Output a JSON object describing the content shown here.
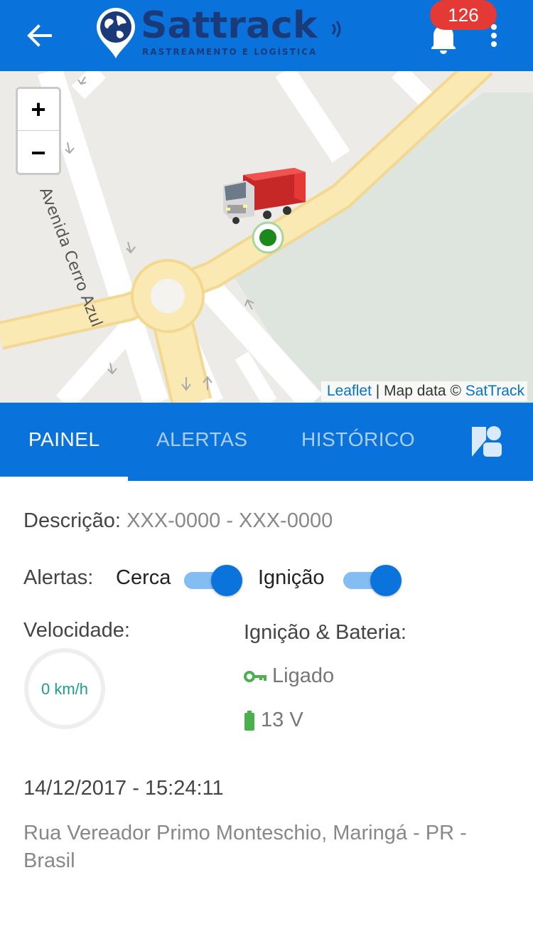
{
  "header": {
    "logo_title": "Sattrack",
    "logo_subtitle": "RASTREAMENTO E LOGÍSTICA",
    "notification_count": "126",
    "icons": [
      "back-arrow-icon",
      "logo-pin-globe-icon",
      "bell-icon",
      "more-vertical-icon"
    ],
    "color": "#0a73db"
  },
  "map": {
    "street_label": "Avenida Cerro Azul",
    "zoom_in_label": "+",
    "zoom_out_label": "−",
    "attribution": {
      "leaflet": "Leaflet",
      "separator": " | Map data © ",
      "provider": "SatTrack"
    },
    "marker_icon": "truck-icon",
    "position_icon": "green-dot-icon"
  },
  "tabs": {
    "items": [
      "PAINEL",
      "ALERTAS",
      "HISTÓRICO"
    ],
    "active": "PAINEL",
    "extra_icon": "user-shapes-icon"
  },
  "panel": {
    "description_label": "Descrição:",
    "description_value": "XXX-0000 - XXX-0000",
    "alerts_label": "Alertas:",
    "fence_label": "Cerca",
    "fence_on": true,
    "ignition_label": "Ignição",
    "ignition_on": true,
    "speed_label": "Velocidade:",
    "speed_value": "0 km/h",
    "ignition_battery_label": "Ignição & Bateria:",
    "ignition_status": "Ligado",
    "battery_value": "13 V",
    "datetime": "14/12/2017 - 15:24:11",
    "address": "Rua Vereador Primo Monteschio, Maringá - PR - Brasil",
    "accent_green": "#4caf50",
    "accent_teal": "#1a9f8a"
  }
}
